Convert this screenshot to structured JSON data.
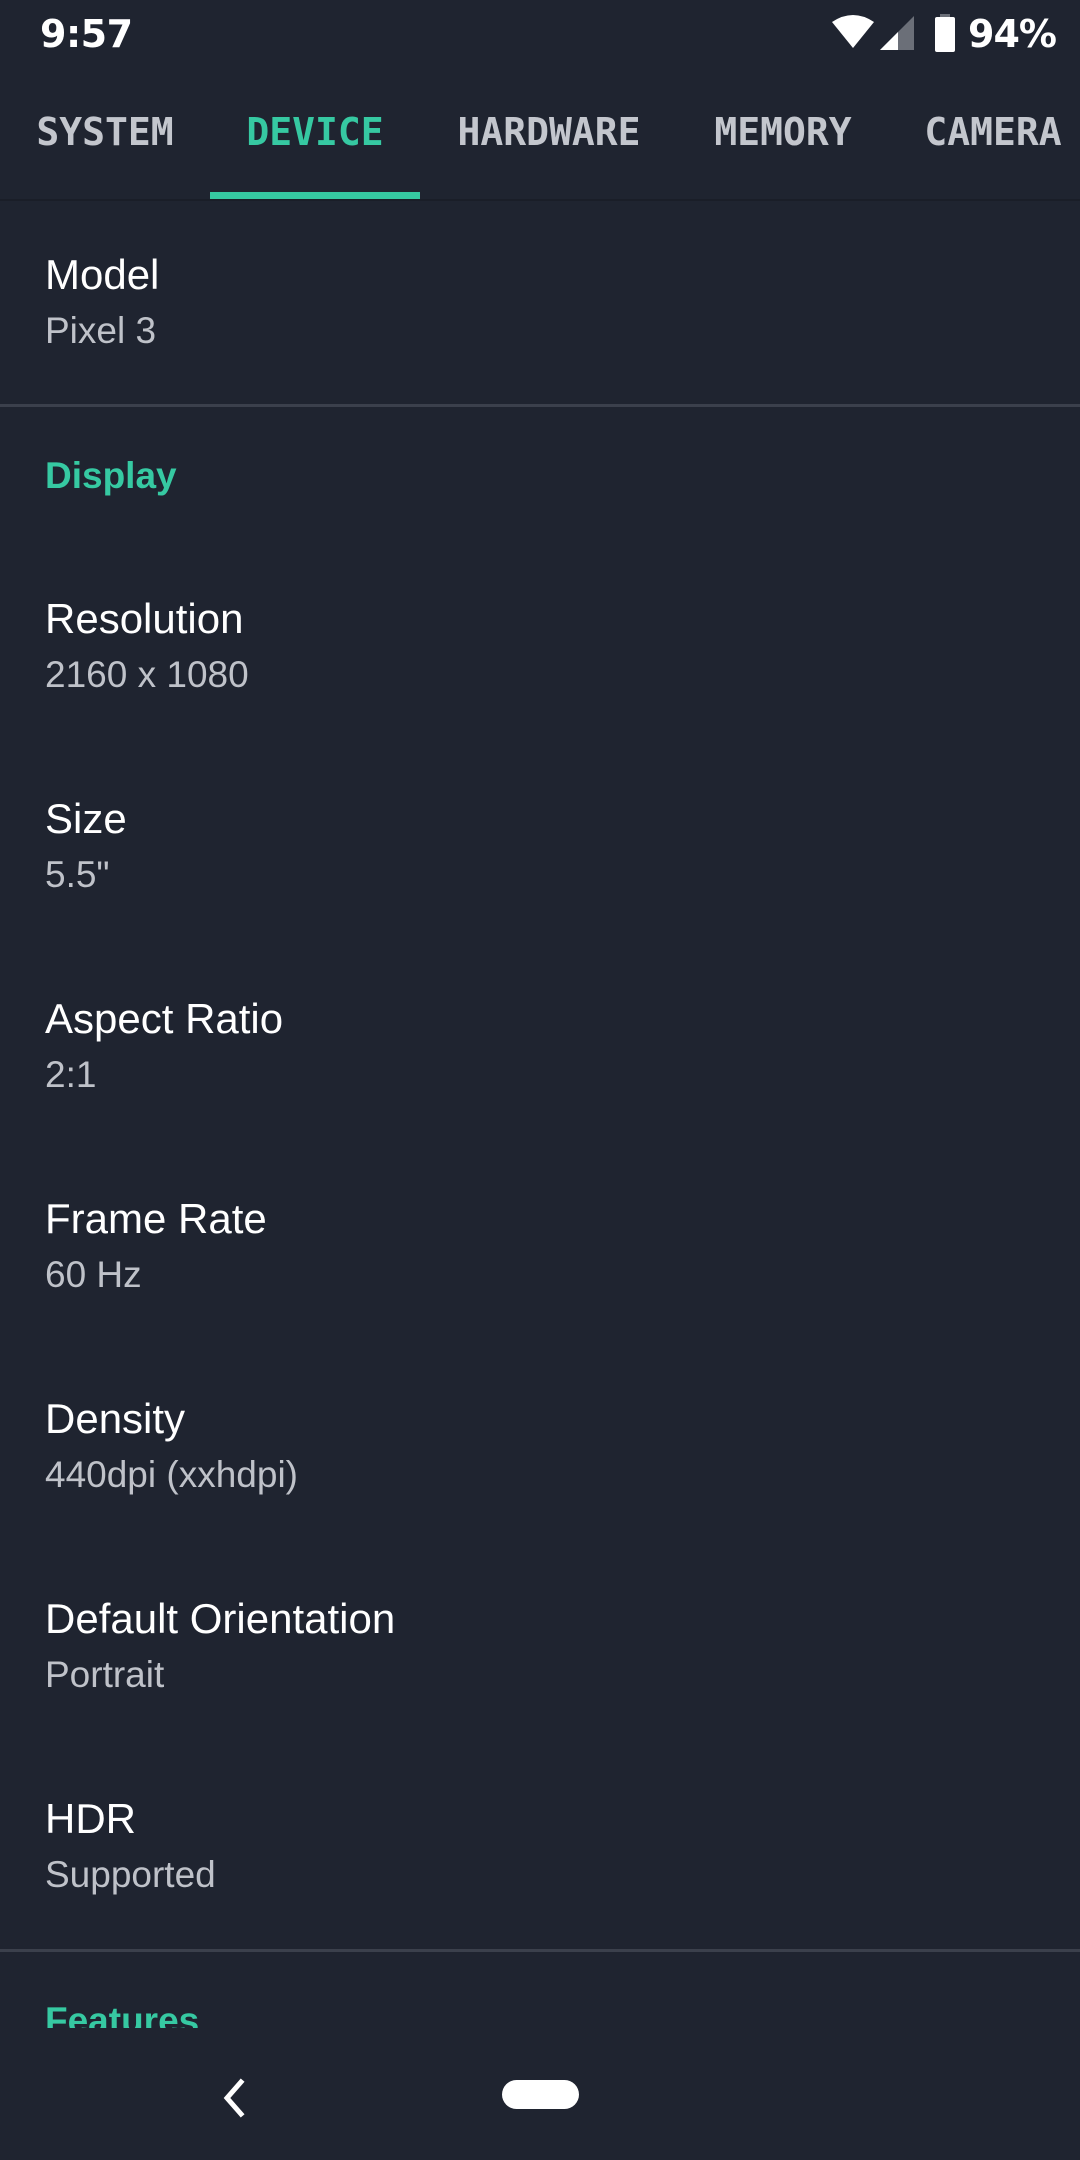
{
  "status_bar": {
    "time": "9:57",
    "battery_percent": "94%",
    "icons": [
      "wifi-icon",
      "cellular-signal-icon",
      "battery-icon"
    ]
  },
  "tabs": [
    {
      "label": "SYSTEM",
      "active": false
    },
    {
      "label": "DEVICE",
      "active": true
    },
    {
      "label": "HARDWARE",
      "active": false
    },
    {
      "label": "MEMORY",
      "active": false
    },
    {
      "label": "CAMERA",
      "active": false
    }
  ],
  "colors": {
    "accent": "#36c9a2",
    "background": "#1f2430",
    "title_text": "#ffffff",
    "value_text": "#bfc2c9",
    "divider": "#3b404c"
  },
  "model": {
    "title": "Model",
    "value": "Pixel 3"
  },
  "display": {
    "header": "Display",
    "items": [
      {
        "title": "Resolution",
        "value": "2160 x 1080"
      },
      {
        "title": "Size",
        "value": "5.5\""
      },
      {
        "title": "Aspect Ratio",
        "value": "2:1"
      },
      {
        "title": "Frame Rate",
        "value": "60 Hz"
      },
      {
        "title": "Density",
        "value": "440dpi (xxhdpi)"
      },
      {
        "title": "Default Orientation",
        "value": "Portrait"
      },
      {
        "title": "HDR",
        "value": "Supported"
      }
    ]
  },
  "features": {
    "header": "Features"
  },
  "nav_bar": {
    "back": "back-icon",
    "home": "home-pill"
  }
}
